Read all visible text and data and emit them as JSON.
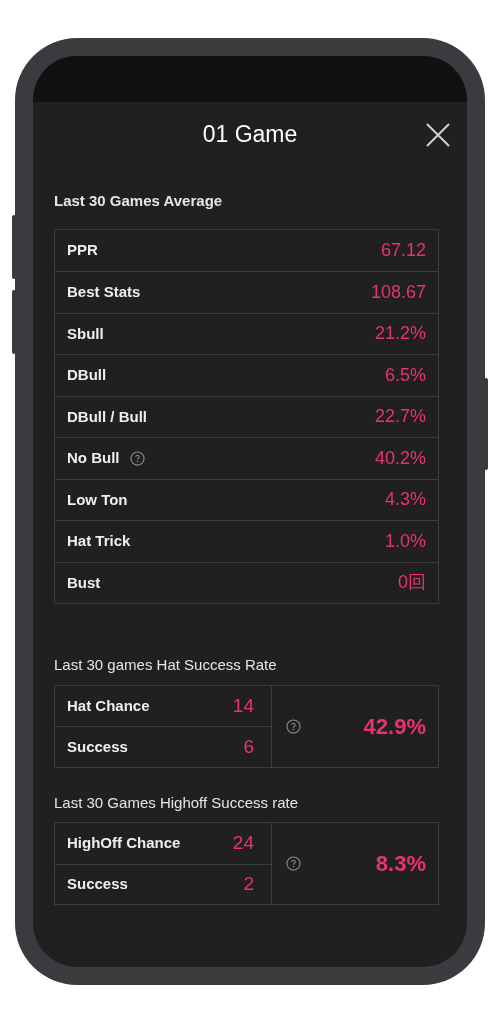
{
  "title": "01 Game",
  "average": {
    "heading": "Last 30 Games Average",
    "rows": [
      {
        "label": "PPR",
        "value": "67.12",
        "help": false
      },
      {
        "label": "Best Stats",
        "value": "108.67",
        "help": false
      },
      {
        "label": "Sbull",
        "value": "21.2%",
        "help": false
      },
      {
        "label": "DBull",
        "value": "6.5%",
        "help": false
      },
      {
        "label": "DBull / Bull",
        "value": "22.7%",
        "help": false
      },
      {
        "label": "No Bull",
        "value": "40.2%",
        "help": true
      },
      {
        "label": "Low Ton",
        "value": "4.3%",
        "help": false
      },
      {
        "label": "Hat Trick",
        "value": "1.0%",
        "help": false
      },
      {
        "label": "Bust",
        "value": "0回",
        "help": false
      }
    ]
  },
  "rates": [
    {
      "heading": "Last 30 games Hat Success Rate",
      "rows": [
        {
          "label": "Hat Chance",
          "value": "14"
        },
        {
          "label": "Success",
          "value": "6"
        }
      ],
      "rate": "42.9%"
    },
    {
      "heading": "Last 30 Games Highoff Success rate",
      "rows": [
        {
          "label": "HighOff Chance",
          "value": "24"
        },
        {
          "label": "Success",
          "value": "2"
        }
      ],
      "rate": "8.3%"
    }
  ]
}
